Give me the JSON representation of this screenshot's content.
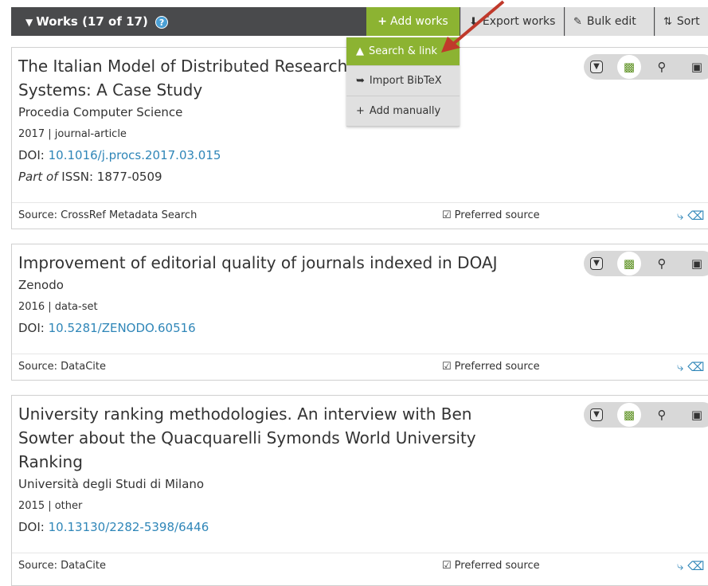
{
  "header": {
    "title": "Works (17 of 17)",
    "help": "?",
    "add_works": "Add works",
    "export_works": "Export works",
    "bulk_edit": "Bulk edit",
    "sort": "Sort"
  },
  "dropdown": {
    "items": [
      {
        "label": "Search & link",
        "icon": "search-link-icon"
      },
      {
        "label": "Import BibTeX",
        "icon": "import-icon"
      },
      {
        "label": "Add manually",
        "icon": "plus-icon"
      }
    ]
  },
  "works": [
    {
      "title": "The Italian Model of Distributed Research Management Systems: A Case Study",
      "journal": "Procedia Computer Science",
      "meta": "2017 | journal-article",
      "doi_label": "DOI:",
      "doi": "10.1016/j.procs.2017.03.015",
      "part_of_label": "Part of",
      "issn": "ISSN: 1877-0509",
      "source": "Source: CrossRef Metadata Search",
      "preferred": "Preferred source"
    },
    {
      "title": "Improvement of editorial quality of journals indexed in DOAJ",
      "journal": "Zenodo",
      "meta": "2016 | data-set",
      "doi_label": "DOI:",
      "doi": "10.5281/ZENODO.60516",
      "source": "Source: DataCite",
      "preferred": "Preferred source"
    },
    {
      "title": "University ranking methodologies. An interview with Ben Sowter about the Quacquarelli Symonds World University Ranking",
      "journal": "Università degli Studi di Milano",
      "meta": "2015 | other",
      "doi_label": "DOI:",
      "doi": "10.13130/2282-5398/6446",
      "source": "Source: DataCite",
      "preferred": "Preferred source"
    }
  ],
  "colors": {
    "header_bg": "#494a4c",
    "accent_green": "#8cb332",
    "link_blue": "#2f86b8",
    "annotation_red": "#c0392b"
  }
}
